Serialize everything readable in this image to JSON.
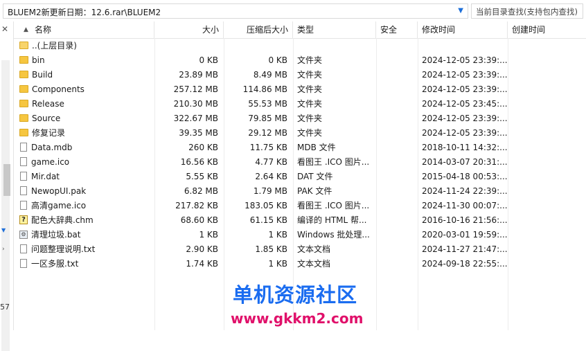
{
  "address": {
    "path": "BLUEM2新更新日期：12.6.rar\\BLUEM2",
    "search_placeholder": "当前目录查找(支持包内查找)"
  },
  "left_pane": {
    "number": "57"
  },
  "columns": {
    "name": "名称",
    "size": "大小",
    "compressed": "压缩后大小",
    "type": "类型",
    "security": "安全",
    "modified": "修改时间",
    "created": "创建时间"
  },
  "files": [
    {
      "name": "..(上层目录)",
      "size": "",
      "compressed": "",
      "type": "",
      "modified": "",
      "icon": "folder-up-icon"
    },
    {
      "name": "bin",
      "size": "0 KB",
      "compressed": "0 KB",
      "type": "文件夹",
      "modified": "2024-12-05 23:39:...",
      "icon": "folder-icon"
    },
    {
      "name": "Build",
      "size": "23.89 MB",
      "compressed": "8.49 MB",
      "type": "文件夹",
      "modified": "2024-12-05 23:39:...",
      "icon": "folder-icon"
    },
    {
      "name": "Components",
      "size": "257.12 MB",
      "compressed": "114.86 MB",
      "type": "文件夹",
      "modified": "2024-12-05 23:39:...",
      "icon": "folder-icon"
    },
    {
      "name": "Release",
      "size": "210.30 MB",
      "compressed": "55.53 MB",
      "type": "文件夹",
      "modified": "2024-12-05 23:45:...",
      "icon": "folder-icon"
    },
    {
      "name": "Source",
      "size": "322.67 MB",
      "compressed": "79.85 MB",
      "type": "文件夹",
      "modified": "2024-12-05 23:39:...",
      "icon": "folder-icon"
    },
    {
      "name": "修复记录",
      "size": "39.35 MB",
      "compressed": "29.12 MB",
      "type": "文件夹",
      "modified": "2024-12-05 23:39:...",
      "icon": "folder-icon"
    },
    {
      "name": "Data.mdb",
      "size": "260 KB",
      "compressed": "11.75 KB",
      "type": "MDB 文件",
      "modified": "2018-10-11 14:32:...",
      "icon": "file-icon"
    },
    {
      "name": "game.ico",
      "size": "16.56 KB",
      "compressed": "4.77 KB",
      "type": "看图王 .ICO 图片...",
      "modified": "2014-03-07 20:31:...",
      "icon": "file-icon"
    },
    {
      "name": "Mir.dat",
      "size": "5.55 KB",
      "compressed": "2.64 KB",
      "type": "DAT 文件",
      "modified": "2015-04-18 00:53:...",
      "icon": "file-icon"
    },
    {
      "name": "NewopUI.pak",
      "size": "6.82 MB",
      "compressed": "1.79 MB",
      "type": "PAK 文件",
      "modified": "2024-11-24 22:39:...",
      "icon": "file-icon"
    },
    {
      "name": "高清game.ico",
      "size": "217.82 KB",
      "compressed": "183.05 KB",
      "type": "看图王 .ICO 图片...",
      "modified": "2024-11-30 00:07:...",
      "icon": "file-icon"
    },
    {
      "name": "配色大辞典.chm",
      "size": "68.60 KB",
      "compressed": "61.15 KB",
      "type": "编译的 HTML 帮...",
      "modified": "2016-10-16 21:56:...",
      "icon": "chm-help-icon"
    },
    {
      "name": "清理垃圾.bat",
      "size": "1 KB",
      "compressed": "1 KB",
      "type": "Windows 批处理...",
      "modified": "2020-03-01 19:59:...",
      "icon": "bat-script-icon"
    },
    {
      "name": "问题整理说明.txt",
      "size": "2.90 KB",
      "compressed": "1.85 KB",
      "type": "文本文档",
      "modified": "2024-11-27 21:47:...",
      "icon": "text-file-icon"
    },
    {
      "name": "一区多服.txt",
      "size": "1.74 KB",
      "compressed": "1 KB",
      "type": "文本文档",
      "modified": "2024-09-18 22:55:...",
      "icon": "text-file-icon"
    }
  ],
  "watermark": {
    "title": "单机资源社区",
    "url": "www.gkkm2.com"
  },
  "colors": {
    "folder": "#f6c640",
    "accent_blue": "#1e6fd9",
    "watermark_blue": "#1a6cf0",
    "watermark_pink": "#e0106a"
  }
}
